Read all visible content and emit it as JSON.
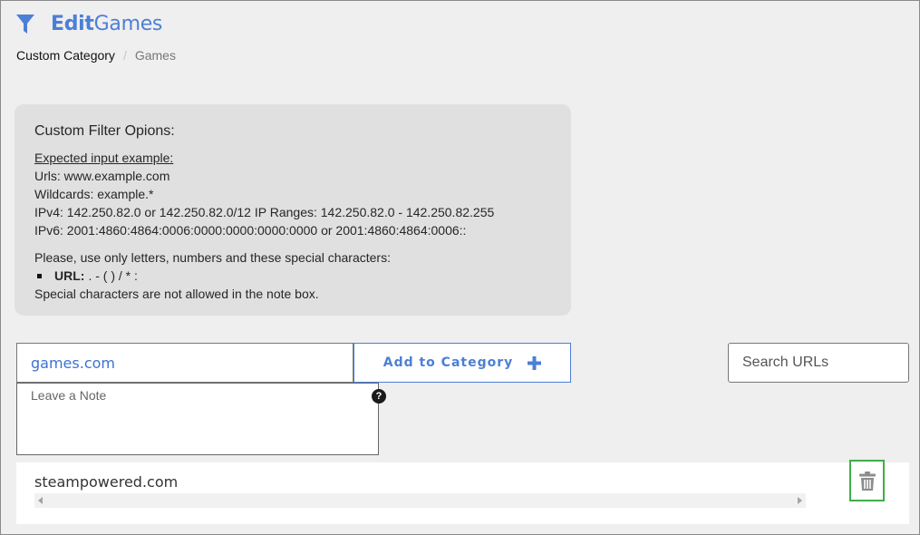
{
  "header": {
    "title_bold": "Edit",
    "title_rest": "Games",
    "icon": "filter-icon"
  },
  "breadcrumb": {
    "parent": "Custom Category",
    "current": "Games",
    "separator": "/"
  },
  "info": {
    "heading": "Custom Filter Opions:",
    "subheading": "Expected input example:",
    "lines": [
      "Urls: www.example.com",
      "Wildcards: example.*",
      "IPv4: 142.250.82.0 or 142.250.82.0/12 IP Ranges: 142.250.82.0 - 142.250.82.255",
      "IPv6: 2001:4860:4864:0006:0000:0000:0000:0000 or 2001:4860:4864:0006::"
    ],
    "special_intro": "Please, use only letters, numbers and these special characters:",
    "url_label": "URL:",
    "url_chars": ". - ( ) / * :",
    "note_rule": "Special characters are not allowed in the note box."
  },
  "form": {
    "url_value": "games.com",
    "add_button_label": "Add to Category",
    "note_placeholder": "Leave a Note",
    "help_glyph": "?",
    "search_placeholder": "Search URLs"
  },
  "list": {
    "items": [
      {
        "url": "steampowered.com"
      }
    ]
  },
  "colors": {
    "accent": "#4c7fd6",
    "delete_border": "#3fae49",
    "panel": "#e0e0e0",
    "background": "#efefef"
  }
}
